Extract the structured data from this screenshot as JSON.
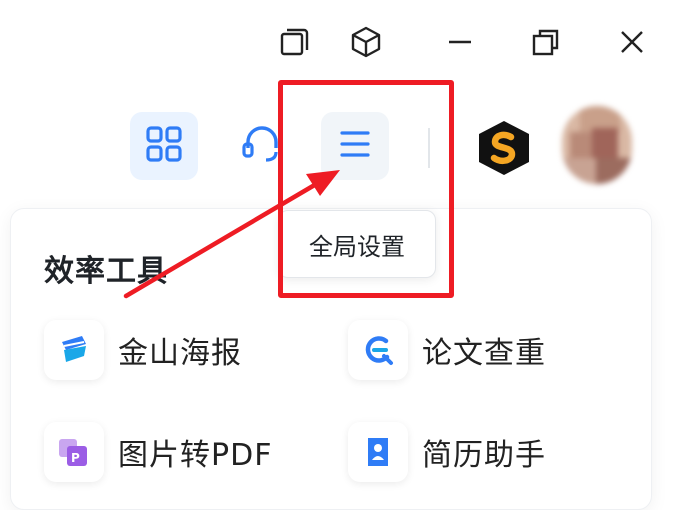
{
  "window_controls": {
    "icons": [
      "restore-window-icon",
      "cube-icon",
      "minimize-icon",
      "maximize-icon",
      "close-icon"
    ]
  },
  "toolbar": {
    "items": [
      "apps-grid-icon",
      "headset-icon",
      "menu-icon",
      "brand-s-logo",
      "user-avatar"
    ],
    "menu_tooltip": "全局设置"
  },
  "panel": {
    "title": "效率工具",
    "tools": [
      {
        "label": "金山海报",
        "icon": "poster-icon"
      },
      {
        "label": "论文查重",
        "icon": "plagiarism-check-icon"
      },
      {
        "label": "图片转PDF",
        "icon": "image-to-pdf-icon"
      },
      {
        "label": "简历助手",
        "icon": "resume-icon"
      }
    ]
  },
  "colors": {
    "accent": "#2f7cf6",
    "highlight": "#ee1c24",
    "grid_bg": "#eaf3ff"
  }
}
